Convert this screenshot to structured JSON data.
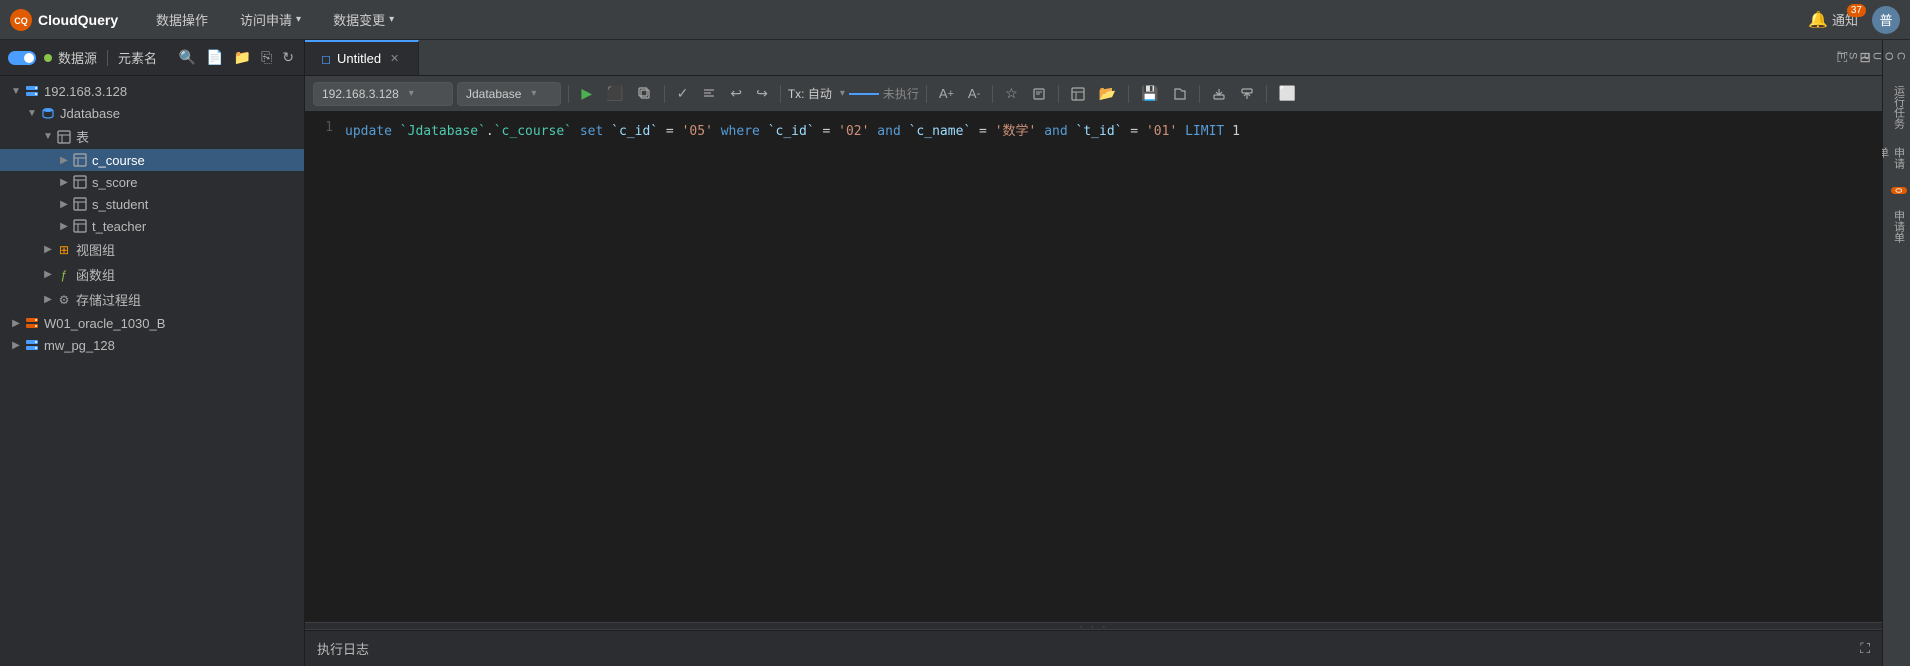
{
  "app": {
    "logo_text": "CloudQuery",
    "logo_initial": "CQ"
  },
  "top_nav": {
    "items": [
      {
        "label": "数据操作",
        "has_arrow": false
      },
      {
        "label": "访问申请",
        "has_arrow": true
      },
      {
        "label": "数据变更",
        "has_arrow": true
      }
    ],
    "notification": {
      "count": "37",
      "label": "通知"
    },
    "avatar_initial": "普"
  },
  "sidebar": {
    "datasource_label": "数据源",
    "element_label": "元素名",
    "tree": [
      {
        "id": "server-1",
        "label": "192.168.3.128",
        "indent": 1,
        "type": "server",
        "expanded": true,
        "has_arrow": true
      },
      {
        "id": "db-1",
        "label": "Jdatabase",
        "indent": 2,
        "type": "db",
        "expanded": true,
        "has_arrow": true
      },
      {
        "id": "tables-group",
        "label": "表",
        "indent": 3,
        "type": "table-group",
        "expanded": true,
        "has_arrow": true
      },
      {
        "id": "c_course",
        "label": "c_course",
        "indent": 4,
        "type": "table",
        "selected": true,
        "has_arrow": true
      },
      {
        "id": "s_score",
        "label": "s_score",
        "indent": 4,
        "type": "table",
        "has_arrow": true
      },
      {
        "id": "s_student",
        "label": "s_student",
        "indent": 4,
        "type": "table",
        "has_arrow": true
      },
      {
        "id": "t_teacher",
        "label": "t_teacher",
        "indent": 4,
        "type": "table",
        "has_arrow": true
      },
      {
        "id": "views-group",
        "label": "视图组",
        "indent": 3,
        "type": "views",
        "has_arrow": true
      },
      {
        "id": "funcs-group",
        "label": "函数组",
        "indent": 3,
        "type": "funcs",
        "has_arrow": true
      },
      {
        "id": "procs-group",
        "label": "存储过程组",
        "indent": 3,
        "type": "procs",
        "has_arrow": true
      },
      {
        "id": "server-2",
        "label": "W01_oracle_1030_B",
        "indent": 1,
        "type": "server-red",
        "has_arrow": true
      },
      {
        "id": "server-3",
        "label": "mw_pg_128",
        "indent": 1,
        "type": "server-blue",
        "has_arrow": true
      }
    ]
  },
  "tabs": {
    "items": [
      {
        "label": "Untitled",
        "active": true,
        "closable": true
      }
    ]
  },
  "sql_toolbar": {
    "host": "192.168.3.128",
    "database": "Jdatabase",
    "tx_label": "Tx: 自动",
    "status": "未执行",
    "buttons": [
      "run",
      "stop",
      "copy-sql",
      "check",
      "format",
      "undo",
      "redo",
      "tx",
      "font-up",
      "font-down",
      "bookmark",
      "snippet",
      "table-view",
      "folder",
      "save",
      "open",
      "export",
      "import",
      "terminal"
    ]
  },
  "editor": {
    "lines": [
      {
        "number": 1,
        "parts": [
          {
            "text": "update",
            "type": "keyword"
          },
          {
            "text": " ",
            "type": "plain"
          },
          {
            "text": "`Jdatabase`",
            "type": "table"
          },
          {
            "text": ".",
            "type": "plain"
          },
          {
            "text": "`c_course`",
            "type": "table"
          },
          {
            "text": " ",
            "type": "plain"
          },
          {
            "text": "set",
            "type": "keyword"
          },
          {
            "text": " ",
            "type": "plain"
          },
          {
            "text": "`c_id`",
            "type": "column"
          },
          {
            "text": " = ",
            "type": "plain"
          },
          {
            "text": "'05'",
            "type": "string"
          },
          {
            "text": " ",
            "type": "plain"
          },
          {
            "text": "where",
            "type": "keyword"
          },
          {
            "text": " ",
            "type": "plain"
          },
          {
            "text": "`c_id`",
            "type": "column"
          },
          {
            "text": " = ",
            "type": "plain"
          },
          {
            "text": "'02'",
            "type": "string"
          },
          {
            "text": " ",
            "type": "plain"
          },
          {
            "text": "and",
            "type": "keyword"
          },
          {
            "text": " ",
            "type": "plain"
          },
          {
            "text": "`c_name`",
            "type": "column"
          },
          {
            "text": " = ",
            "type": "plain"
          },
          {
            "text": "'数学'",
            "type": "string"
          },
          {
            "text": " ",
            "type": "plain"
          },
          {
            "text": "and",
            "type": "keyword"
          },
          {
            "text": " ",
            "type": "plain"
          },
          {
            "text": "`t_id`",
            "type": "column"
          },
          {
            "text": " = ",
            "type": "plain"
          },
          {
            "text": "'01'",
            "type": "string"
          },
          {
            "text": " ",
            "type": "plain"
          },
          {
            "text": "LIMIT",
            "type": "keyword"
          },
          {
            "text": " 1",
            "type": "plain"
          }
        ]
      }
    ]
  },
  "log": {
    "label": "执行日志"
  },
  "right_panel": {
    "items": [
      {
        "label": "C\nO\nU\nR\nS\nE"
      },
      {
        "label": "运行任务"
      },
      {
        "label": "申请单"
      },
      {
        "label": "0",
        "badge": true
      },
      {
        "label": "申请单"
      }
    ]
  }
}
